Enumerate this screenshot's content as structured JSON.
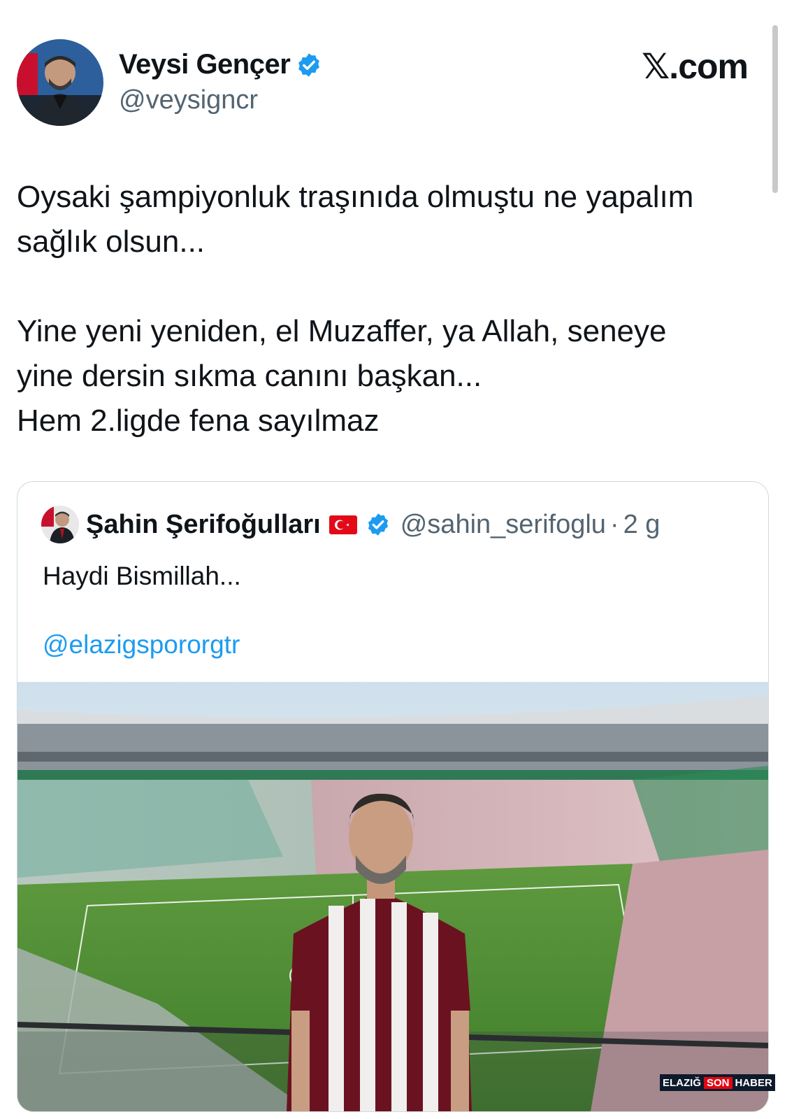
{
  "site": "𝕏.com",
  "author": {
    "name": "Veysi Gençer",
    "handle": "@veysigncr"
  },
  "tweet": {
    "text": "Oysaki şampiyonluk traşınıda olmuştu ne yapalım\nsağlık olsun...\n\nYine yeni yeniden, el Muzaffer, ya Allah, seneye\nyine dersin sıkma canını başkan...\nHem 2.ligde fena sayılmaz"
  },
  "quote": {
    "name": "Şahin Şerifoğulları",
    "handle": "@sahin_serifoglu",
    "separator": "·",
    "time": "2 g",
    "text": "Haydi Bismillah...",
    "mention": "@elazigspororgtr"
  },
  "watermark": {
    "part1": "ELAZIĞ",
    "part2": "SON",
    "part3": "HABER"
  },
  "colors": {
    "verified": "#1d9bf0",
    "handle": "#536471",
    "link": "#1d9bf0"
  },
  "icons": [
    "verified-badge-icon",
    "turkish-flag-icon"
  ]
}
